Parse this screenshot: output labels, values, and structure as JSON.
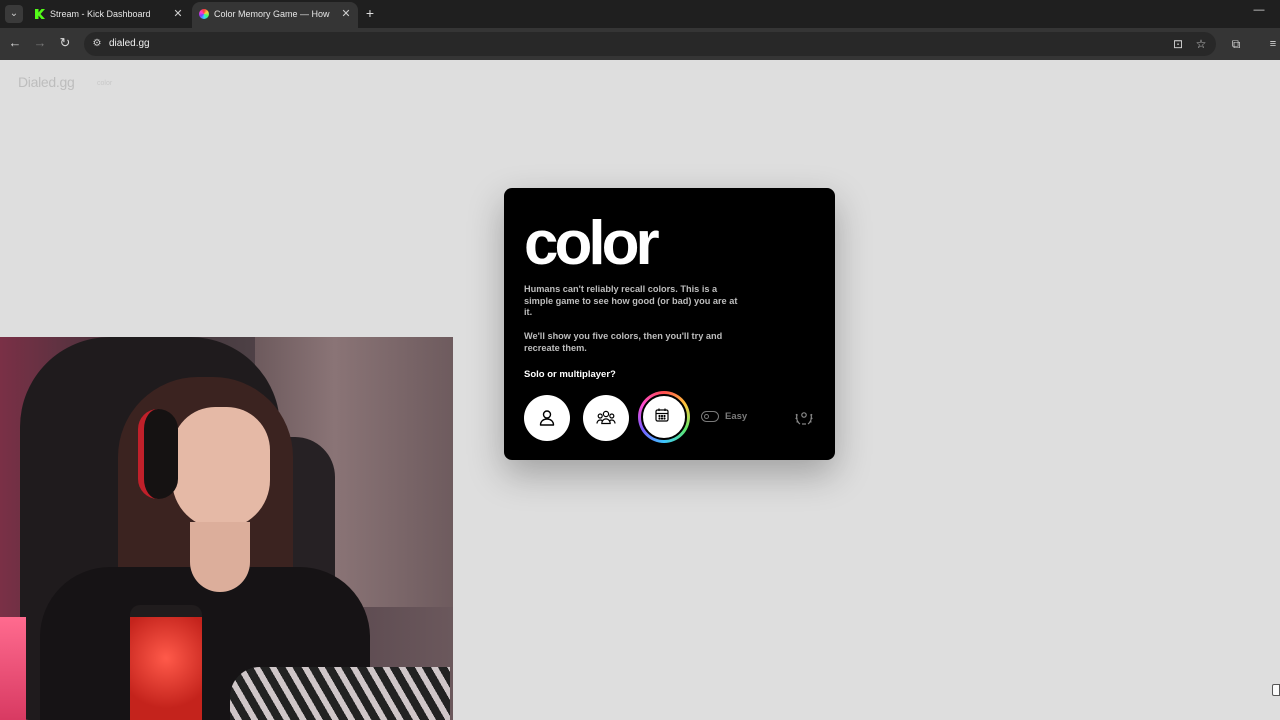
{
  "browser": {
    "tabs": [
      {
        "title": "Stream - Kick Dashboard",
        "favicon": "kick-icon",
        "active": false
      },
      {
        "title": "Color Memory Game — How W",
        "favicon": "color-wheel-icon",
        "active": true
      }
    ],
    "url": "dialed.gg",
    "new_tab_glyph": "+",
    "close_glyph": "✕"
  },
  "site": {
    "logo": "Dialed.gg",
    "sub_label": "color"
  },
  "card": {
    "title": "color",
    "description_1": "Humans can't reliably recall colors. This is a simple game to see how good (or bad) you are at it.",
    "description_2": "We'll show you five colors, then you'll try and recreate them.",
    "question": "Solo or multiplayer?",
    "modes": [
      {
        "name": "solo",
        "icon": "person-icon"
      },
      {
        "name": "multiplayer",
        "icon": "group-icon"
      },
      {
        "name": "daily",
        "icon": "calendar-icon"
      }
    ],
    "difficulty_label": "Easy",
    "difficulty_enabled": false,
    "leaderboard_icon": "laurel-icon"
  },
  "colors": {
    "page_bg": "#dedede",
    "card_bg": "#000000",
    "tabbar_bg": "#1f1f1f",
    "toolbar_bg": "#353535"
  }
}
